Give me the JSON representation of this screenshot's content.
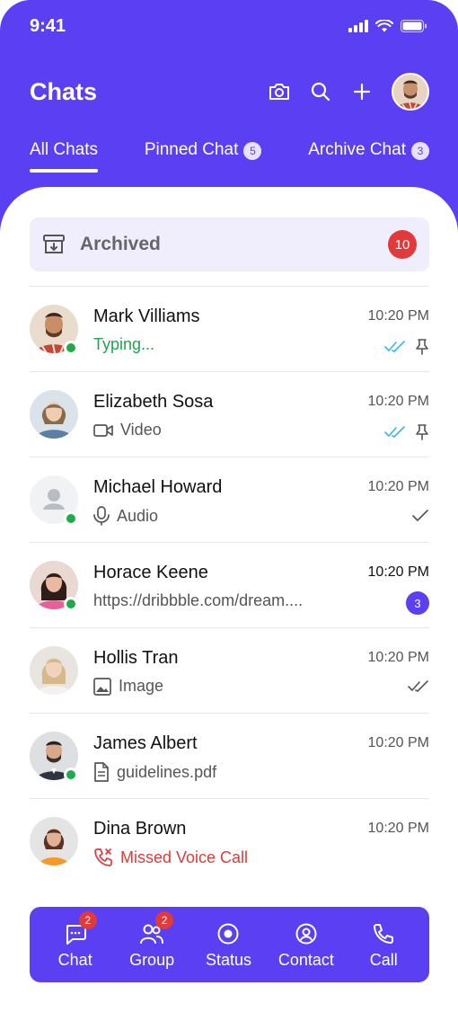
{
  "status_bar": {
    "time": "9:41"
  },
  "header": {
    "title": "Chats"
  },
  "tabs": [
    {
      "label": "All Chats",
      "badge": null,
      "active": true
    },
    {
      "label": "Pinned Chat",
      "badge": "5"
    },
    {
      "label": "Archive Chat",
      "badge": "3"
    }
  ],
  "archived": {
    "label": "Archived",
    "count": "10"
  },
  "chats": [
    {
      "name": "Mark Villiams",
      "time": "10:20 PM",
      "preview": "Typing...",
      "preview_icon": "none",
      "status": "read-pinned",
      "online": true
    },
    {
      "name": "Elizabeth Sosa",
      "time": "10:20 PM",
      "preview": "Video",
      "preview_icon": "video-icon",
      "status": "read-pinned",
      "online": false
    },
    {
      "name": "Michael Howard",
      "time": "10:20 PM",
      "preview": "Audio",
      "preview_icon": "mic-icon",
      "status": "sent",
      "online": true
    },
    {
      "name": "Horace Keene",
      "time": "10:20 PM",
      "preview": "https://dribbble.com/dream....",
      "preview_icon": "none",
      "unread": "3",
      "online": true
    },
    {
      "name": "Hollis Tran",
      "time": "10:20 PM",
      "preview": "Image",
      "preview_icon": "image-icon",
      "status": "delivered",
      "online": false
    },
    {
      "name": "James Albert",
      "time": "10:20 PM",
      "preview": "guidelines.pdf",
      "preview_icon": "document-icon",
      "status": "none",
      "online": true
    },
    {
      "name": "Dina Brown",
      "time": "10:20 PM",
      "preview": "Missed Voice Call",
      "preview_icon": "missed-call-icon",
      "status": "none",
      "online": false
    }
  ],
  "bottom_nav": [
    {
      "label": "Chat",
      "icon": "chat-icon",
      "badge": "2"
    },
    {
      "label": "Group",
      "icon": "group-icon",
      "badge": "2"
    },
    {
      "label": "Status",
      "icon": "status-icon",
      "badge": null
    },
    {
      "label": "Contact",
      "icon": "contact-icon",
      "badge": null
    },
    {
      "label": "Call",
      "icon": "phone-icon",
      "badge": null
    }
  ],
  "colors": {
    "accent": "#5b3ff2",
    "online": "#1faa4b",
    "alert": "#e03a3a",
    "read_ticks": "#34b7f1"
  }
}
